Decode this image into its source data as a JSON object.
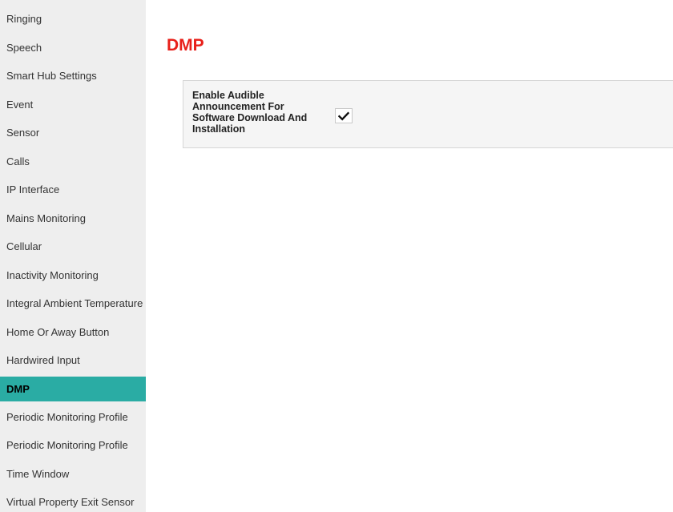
{
  "sidebar": {
    "items": [
      {
        "label": "Ringing"
      },
      {
        "label": "Speech"
      },
      {
        "label": "Smart Hub Settings"
      },
      {
        "label": "Event"
      },
      {
        "label": "Sensor"
      },
      {
        "label": "Calls"
      },
      {
        "label": "IP Interface"
      },
      {
        "label": "Mains Monitoring"
      },
      {
        "label": "Cellular"
      },
      {
        "label": "Inactivity Monitoring"
      },
      {
        "label": "Integral Ambient Temperature"
      },
      {
        "label": "Home Or Away Button"
      },
      {
        "label": "Hardwired Input"
      },
      {
        "label": "DMP"
      },
      {
        "label": "Periodic Monitoring Profile"
      },
      {
        "label": "Periodic Monitoring Profile"
      },
      {
        "label": "Time Window"
      },
      {
        "label": "Virtual Property Exit Sensor"
      }
    ],
    "active_label": "DMP"
  },
  "main": {
    "title": "DMP",
    "settings": [
      {
        "label": "Enable Audible Announcement For Software Download And Installation",
        "checked": true,
        "icon": "checkmark-icon"
      }
    ]
  },
  "colors": {
    "title": "#e8201a",
    "active_item": "#2aaca4",
    "sidebar_bg": "#eeeeee",
    "panel_bg": "#f5f5f5"
  }
}
